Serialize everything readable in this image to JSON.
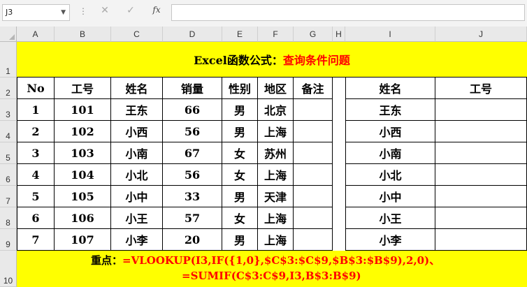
{
  "formula_bar": {
    "name_box": "J3",
    "cancel_icon": "✕",
    "enter_icon": "✓",
    "fx_label": "fx",
    "formula": ""
  },
  "columns": [
    "A",
    "B",
    "C",
    "D",
    "E",
    "F",
    "G",
    "H",
    "I",
    "J"
  ],
  "rows": [
    "1",
    "2",
    "3",
    "4",
    "5",
    "6",
    "7",
    "8",
    "9",
    "10"
  ],
  "title": {
    "prefix": "Excel函数公式：",
    "highlight": "查询条件问题"
  },
  "table1": {
    "headers": [
      "No",
      "工号",
      "姓名",
      "销量",
      "性别",
      "地区",
      "备注"
    ],
    "rows": [
      [
        "1",
        "101",
        "王东",
        "66",
        "男",
        "北京",
        ""
      ],
      [
        "2",
        "102",
        "小西",
        "56",
        "男",
        "上海",
        ""
      ],
      [
        "3",
        "103",
        "小南",
        "67",
        "女",
        "苏州",
        ""
      ],
      [
        "4",
        "104",
        "小北",
        "56",
        "女",
        "上海",
        ""
      ],
      [
        "5",
        "105",
        "小中",
        "33",
        "男",
        "天津",
        ""
      ],
      [
        "6",
        "106",
        "小王",
        "57",
        "女",
        "上海",
        ""
      ],
      [
        "7",
        "107",
        "小李",
        "20",
        "男",
        "上海",
        ""
      ]
    ]
  },
  "table2": {
    "headers": [
      "姓名",
      "工号"
    ],
    "rows": [
      [
        "王东",
        ""
      ],
      [
        "小西",
        ""
      ],
      [
        "小南",
        ""
      ],
      [
        "小北",
        ""
      ],
      [
        "小中",
        ""
      ],
      [
        "小王",
        ""
      ],
      [
        "小李",
        ""
      ]
    ]
  },
  "note": {
    "label": "重点：",
    "line1": "=VLOOKUP(I3,IF({1,0},$C$3:$C$9,$B$3:$B$9),2,0)、",
    "line2": "=SUMIF(C$3:C$9,I3,B$3:B$9)"
  },
  "colors": {
    "highlight_fill": "#ffff00",
    "accent_text": "#ff0000"
  }
}
